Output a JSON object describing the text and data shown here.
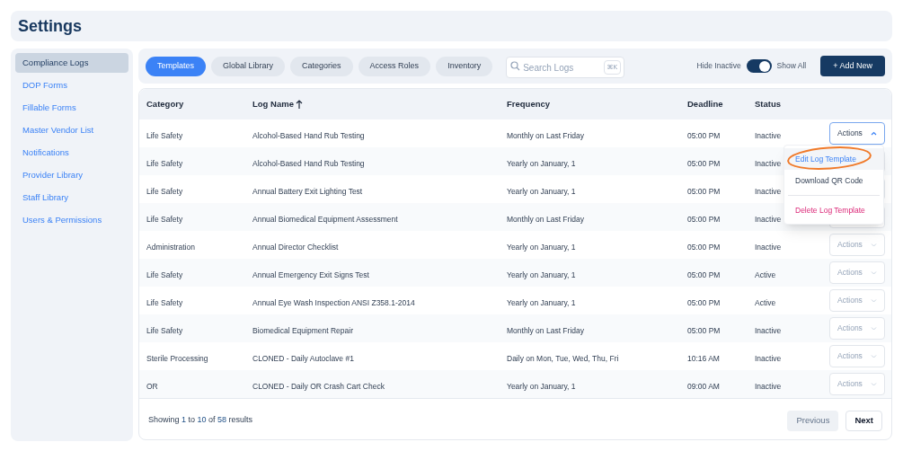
{
  "header": {
    "title": "Settings"
  },
  "sidebar": {
    "items": [
      {
        "label": "Compliance Logs",
        "selected": true
      },
      {
        "label": "DOP Forms",
        "selected": false
      },
      {
        "label": "Fillable Forms",
        "selected": false
      },
      {
        "label": "Master Vendor List",
        "selected": false
      },
      {
        "label": "Notifications",
        "selected": false
      },
      {
        "label": "Provider Library",
        "selected": false
      },
      {
        "label": "Staff Library",
        "selected": false
      },
      {
        "label": "Users & Permissions",
        "selected": false
      }
    ]
  },
  "toolbar": {
    "tabs": [
      {
        "label": "Templates",
        "selected": true
      },
      {
        "label": "Global Library",
        "selected": false
      },
      {
        "label": "Categories",
        "selected": false
      },
      {
        "label": "Access Roles",
        "selected": false
      },
      {
        "label": "Inventory",
        "selected": false
      }
    ],
    "search": {
      "placeholder": "Search Logs",
      "shortcut": "⌘K"
    },
    "toggle": {
      "off_label": "Hide Inactive",
      "on": true,
      "on_label": "Show All"
    },
    "add_button": "+ Add New"
  },
  "table": {
    "columns": [
      {
        "label": "Category",
        "sorted": false
      },
      {
        "label": "Log Name",
        "sorted": true
      },
      {
        "label": "Frequency",
        "sorted": false
      },
      {
        "label": "Deadline",
        "sorted": false
      },
      {
        "label": "Status",
        "sorted": false
      }
    ],
    "rows": [
      {
        "cells": [
          "Life Safety",
          "Alcohol-Based Hand Rub Testing",
          "Monthly on Last Friday",
          "05:00 PM",
          "Inactive"
        ],
        "actions": {
          "label": "Actions",
          "expanded": true
        }
      },
      {
        "cells": [
          "Life Safety",
          "Alcohol-Based Hand Rub Testing",
          "Yearly on January, 1",
          "05:00 PM",
          "Inactive"
        ],
        "actions": {
          "expanded": false
        }
      },
      {
        "cells": [
          "Life Safety",
          "Annual Battery Exit Lighting Test",
          "Yearly on January, 1",
          "05:00 PM",
          "Inactive"
        ],
        "actions": {
          "expanded": false
        }
      },
      {
        "cells": [
          "Life Safety",
          "Annual Biomedical Equipment Assessment",
          "Monthly on Last Friday",
          "05:00 PM",
          "Inactive"
        ],
        "actions": {
          "expanded": false
        }
      },
      {
        "cells": [
          "Administration",
          "Annual Director Checklist",
          "Yearly on January, 1",
          "05:00 PM",
          "Inactive"
        ],
        "actions": {
          "label": "Actions",
          "expanded": false
        }
      },
      {
        "cells": [
          "Life Safety",
          "Annual Emergency Exit Signs Test",
          "Yearly on January, 1",
          "05:00 PM",
          "Active"
        ],
        "actions": {
          "label": "Actions",
          "expanded": false
        }
      },
      {
        "cells": [
          "Life Safety",
          "Annual Eye Wash Inspection ANSI Z358.1-2014",
          "Yearly on January, 1",
          "05:00 PM",
          "Active"
        ],
        "actions": {
          "label": "Actions",
          "expanded": false
        }
      },
      {
        "cells": [
          "Life Safety",
          "Biomedical Equipment Repair",
          "Monthly on Last Friday",
          "05:00 PM",
          "Inactive"
        ],
        "actions": {
          "label": "Actions",
          "expanded": false
        }
      },
      {
        "cells": [
          "Sterile Processing",
          "CLONED - Daily Autoclave #1",
          "Daily on Mon, Tue, Wed, Thu, Fri",
          "10:16 AM",
          "Inactive"
        ],
        "actions": {
          "label": "Actions",
          "expanded": false
        }
      },
      {
        "cells": [
          "OR",
          "CLONED - Daily OR Crash Cart Check",
          "Yearly on January, 1",
          "09:00 AM",
          "Inactive"
        ],
        "actions": {
          "label": "Actions",
          "expanded": false
        }
      }
    ],
    "menu": [
      {
        "label": "Edit Log Template",
        "kind": "edit",
        "highlighted": true,
        "circled": true
      },
      {
        "label": "Download QR Code",
        "kind": "normal",
        "highlighted": false,
        "circled": false
      },
      {
        "label": "Delete Log Template",
        "kind": "danger",
        "highlighted": false,
        "circled": false
      }
    ]
  },
  "footer": {
    "summary": "Showing **1** to **10** of **58** results",
    "buttons": [
      {
        "label": "Previous",
        "disabled": true
      },
      {
        "label": "Next",
        "disabled": false
      }
    ]
  }
}
